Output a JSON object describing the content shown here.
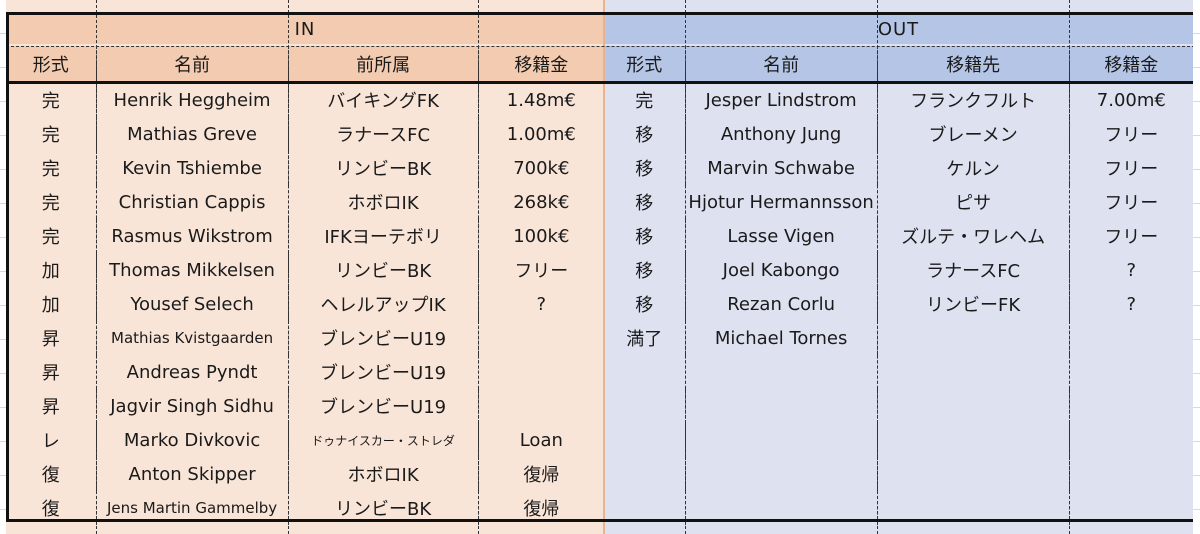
{
  "in": {
    "title": "IN",
    "headers": [
      "形式",
      "名前",
      "前所属",
      "移籍金"
    ],
    "rows": [
      [
        "完",
        "Henrik Heggheim",
        "バイキングFK",
        "1.48m€"
      ],
      [
        "完",
        "Mathias Greve",
        "ラナースFC",
        "1.00m€"
      ],
      [
        "完",
        "Kevin Tshiembe",
        "リンビーBK",
        "700k€"
      ],
      [
        "完",
        "Christian Cappis",
        "ホボロIK",
        "268k€"
      ],
      [
        "完",
        "Rasmus Wikstrom",
        "IFKヨーテボリ",
        "100k€"
      ],
      [
        "加",
        "Thomas Mikkelsen",
        "リンビーBK",
        "フリー"
      ],
      [
        "加",
        "Yousef Selech",
        "ヘレルアップIK",
        "?"
      ],
      [
        "昇",
        "Mathias Kvistgaarden",
        "ブレンビーU19",
        ""
      ],
      [
        "昇",
        "Andreas Pyndt",
        "ブレンビーU19",
        ""
      ],
      [
        "昇",
        "Jagvir Singh Sidhu",
        "ブレンビーU19",
        ""
      ],
      [
        "レ",
        "Marko Divkovic",
        "ドゥナイスカー・ストレダ",
        "Loan"
      ],
      [
        "復",
        "Anton Skipper",
        "ホボロIK",
        "復帰"
      ],
      [
        "復",
        "Jens Martin Gammelby",
        "リンビーBK",
        "復帰"
      ]
    ]
  },
  "out": {
    "title": "OUT",
    "headers": [
      "形式",
      "名前",
      "移籍先",
      "移籍金"
    ],
    "rows": [
      [
        "完",
        "Jesper Lindstrom",
        "フランクフルト",
        "7.00m€"
      ],
      [
        "移",
        "Anthony Jung",
        "ブレーメン",
        "フリー"
      ],
      [
        "移",
        "Marvin Schwabe",
        "ケルン",
        "フリー"
      ],
      [
        "移",
        "Hjotur Hermannsson",
        "ピサ",
        "フリー"
      ],
      [
        "移",
        "Lasse Vigen",
        "ズルテ・ワレヘム",
        "フリー"
      ],
      [
        "移",
        "Joel Kabongo",
        "ラナースFC",
        "?"
      ],
      [
        "移",
        "Rezan Corlu",
        "リンビーFK",
        "?"
      ],
      [
        "満了",
        "Michael Tornes",
        "",
        ""
      ],
      [
        "",
        "",
        "",
        ""
      ],
      [
        "",
        "",
        "",
        ""
      ],
      [
        "",
        "",
        "",
        ""
      ],
      [
        "",
        "",
        "",
        ""
      ],
      [
        "",
        "",
        "",
        ""
      ]
    ]
  }
}
